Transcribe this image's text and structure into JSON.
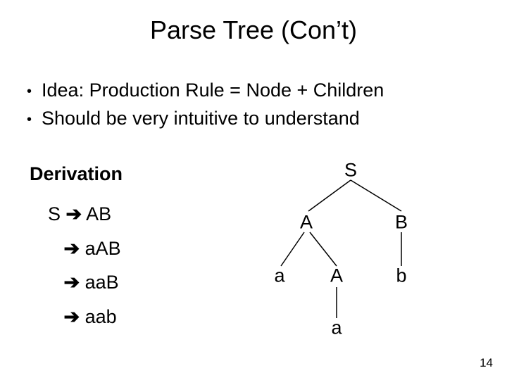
{
  "title": "Parse Tree (Con’t)",
  "bullets": [
    "Idea: Production Rule = Node + Children",
    "Should be very intuitive to understand"
  ],
  "derivation": {
    "label": "Derivation",
    "lines": {
      "l0_left": "S ",
      "l0_right": " AB",
      "l1_right": " aAB",
      "l2_right": " aaB",
      "l3_right": " aab"
    }
  },
  "arrow_glyph": "➔",
  "bullet_glyph": "•",
  "tree": {
    "S": "S",
    "A": "A",
    "B": "B",
    "a1": "a",
    "A2": "A",
    "b": "b",
    "a2": "a"
  },
  "page_number": "14"
}
